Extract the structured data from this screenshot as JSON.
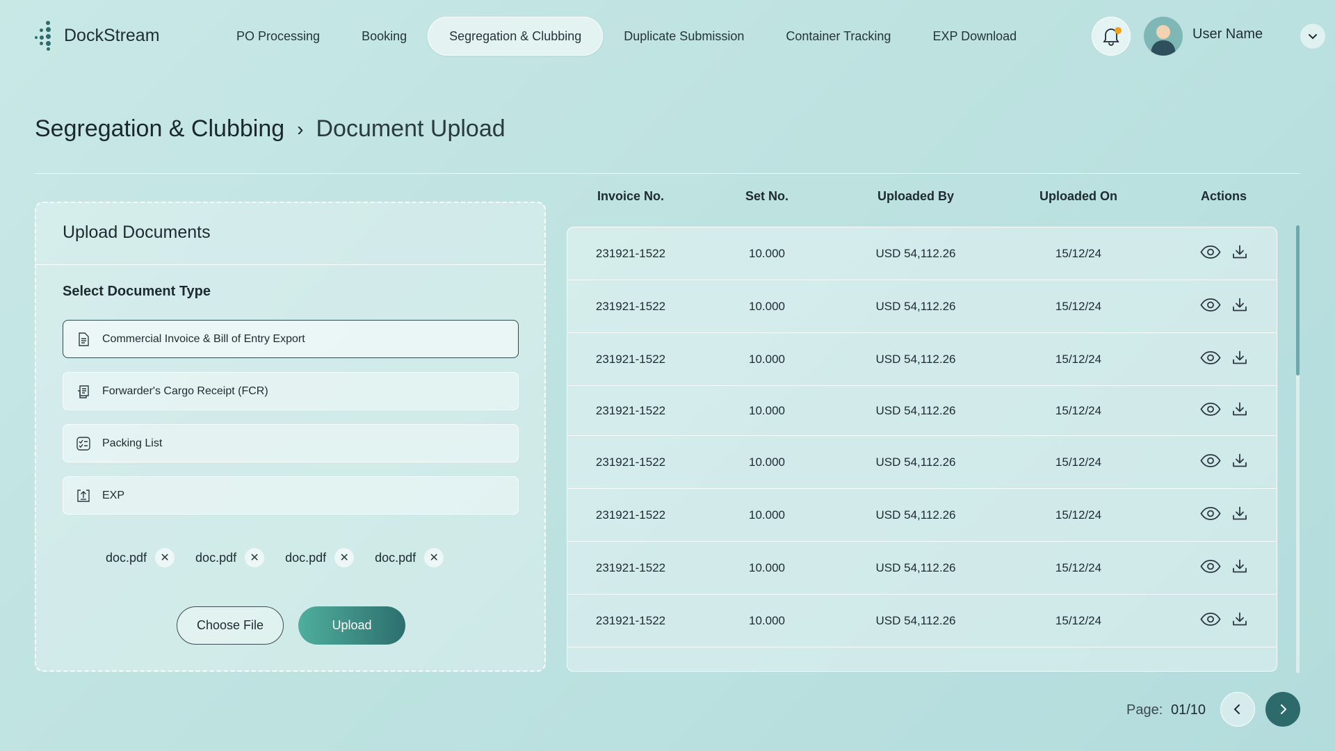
{
  "app": {
    "name": "DockStream"
  },
  "nav": {
    "items": [
      {
        "label": "PO Processing",
        "active": false
      },
      {
        "label": "Booking",
        "active": false
      },
      {
        "label": "Segregation & Clubbing",
        "active": true
      },
      {
        "label": "Duplicate Submission",
        "active": false
      },
      {
        "label": "Container Tracking",
        "active": false
      },
      {
        "label": "EXP Download",
        "active": false
      }
    ]
  },
  "user": {
    "name": "User Name",
    "has_notification": true
  },
  "breadcrumb": {
    "parent": "Segregation & Clubbing",
    "separator": "›",
    "current": "Document Upload"
  },
  "upload": {
    "title": "Upload Documents",
    "subtitle": "Select Document Type",
    "doc_types": [
      {
        "label": "Commercial Invoice & Bill of Entry Export",
        "icon": "document-icon",
        "selected": true
      },
      {
        "label": "Forwarder's Cargo Receipt (FCR)",
        "icon": "receipt-icon",
        "selected": false
      },
      {
        "label": "Packing List",
        "icon": "checklist-icon",
        "selected": false
      },
      {
        "label": "EXP",
        "icon": "upload-box-icon",
        "selected": false
      }
    ],
    "files": [
      "doc.pdf",
      "doc.pdf",
      "doc.pdf",
      "doc.pdf"
    ],
    "choose_label": "Choose File",
    "upload_label": "Upload"
  },
  "table": {
    "headers": [
      "Invoice No.",
      "Set No.",
      "Uploaded By",
      "Uploaded On",
      "Actions"
    ],
    "rows": [
      {
        "invoice": "231921-1522",
        "set": "10.000",
        "by": "USD 54,112.26",
        "on": "15/12/24"
      },
      {
        "invoice": "231921-1522",
        "set": "10.000",
        "by": "USD 54,112.26",
        "on": "15/12/24"
      },
      {
        "invoice": "231921-1522",
        "set": "10.000",
        "by": "USD 54,112.26",
        "on": "15/12/24"
      },
      {
        "invoice": "231921-1522",
        "set": "10.000",
        "by": "USD 54,112.26",
        "on": "15/12/24"
      },
      {
        "invoice": "231921-1522",
        "set": "10.000",
        "by": "USD 54,112.26",
        "on": "15/12/24"
      },
      {
        "invoice": "231921-1522",
        "set": "10.000",
        "by": "USD 54,112.26",
        "on": "15/12/24"
      },
      {
        "invoice": "231921-1522",
        "set": "10.000",
        "by": "USD 54,112.26",
        "on": "15/12/24"
      },
      {
        "invoice": "231921-1522",
        "set": "10.000",
        "by": "USD 54,112.26",
        "on": "15/12/24"
      }
    ]
  },
  "pagination": {
    "label": "Page:",
    "value": "01/10"
  },
  "colors": {
    "accent": "#2d6a6c",
    "accent_light": "#4fae9d",
    "notification": "#f0a21a"
  }
}
